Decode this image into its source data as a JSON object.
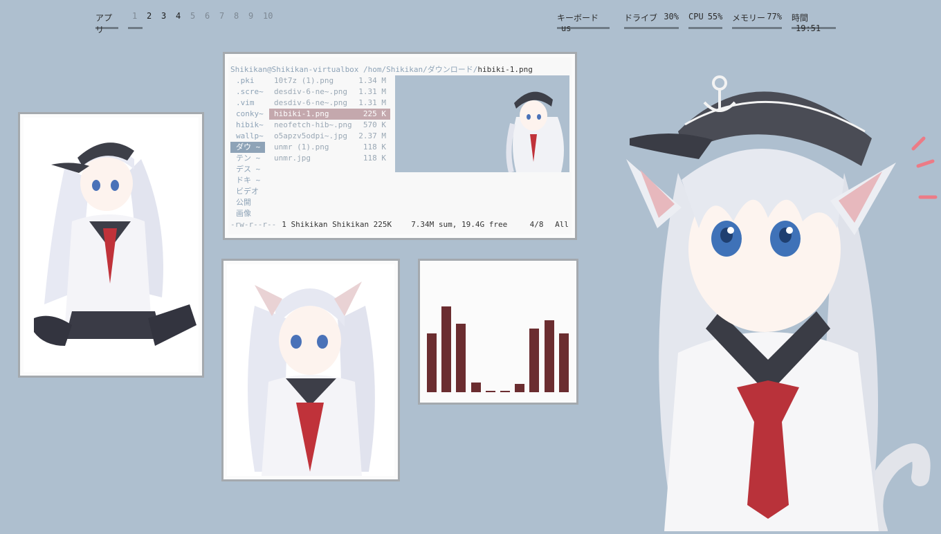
{
  "topbar": {
    "apps_label": "アプリ",
    "workspaces": [
      "1",
      "2",
      "3",
      "4",
      "5",
      "6",
      "7",
      "8",
      "9",
      "10"
    ],
    "active_workspaces": [
      "2",
      "3",
      "4"
    ],
    "stats": {
      "keyboard": {
        "label": "キーボード",
        "value": "us"
      },
      "drive": {
        "label": "ドライブ",
        "value": "30%"
      },
      "cpu": {
        "label": "CPU",
        "value": "55%"
      },
      "memory": {
        "label": "メモリー",
        "value": "77%"
      },
      "clock": {
        "label": "時間",
        "value": "19:51"
      }
    }
  },
  "terminal": {
    "path_prefix": "Shikikan@Shikikan-virtualbox /hom/Shikikan/ダウンロード/",
    "path_current": "hibiki-1.png",
    "left_column": [
      ".pki",
      ".scre~",
      ".vim",
      "conky~",
      "hibik~",
      "wallp~",
      "ダウ ~",
      "テン ~",
      "デス ~",
      "ドキ ~",
      "ビデオ",
      "公開",
      "画像"
    ],
    "left_selected_index": 6,
    "files": [
      {
        "name": "10t7z (1).png",
        "size": "1.34 M"
      },
      {
        "name": "desdiv-6-ne~.png",
        "size": "1.31 M"
      },
      {
        "name": "desdiv-6-ne~.png",
        "size": "1.31 M"
      },
      {
        "name": "hibiki-1.png",
        "size": "225 K"
      },
      {
        "name": "neofetch-hib~.png",
        "size": "570 K"
      },
      {
        "name": "o5apzv5odpi~.jpg",
        "size": "2.37 M"
      },
      {
        "name": "unmr (1).png",
        "size": "118 K"
      },
      {
        "name": "unmr.jpg",
        "size": "118 K"
      }
    ],
    "files_selected_index": 3,
    "status": {
      "perms": "-rw-r--r--",
      "info": "1 Shikikan Shikikan 225K",
      "sum": "7.34M sum, 19.4G free",
      "position": "4/8",
      "scroll": "All"
    }
  },
  "visualizer": {
    "levels": [
      0.5,
      0.73,
      0.58,
      0.08,
      0.01,
      0.01,
      0.07,
      0.54,
      0.61,
      0.5
    ],
    "color": "#6b2d30"
  },
  "colors": {
    "background": "#aebfcf",
    "accent_bar": "#6b2d30",
    "selection_highlight": "#c4a8ad"
  },
  "icons": {
    "anchor": "anchor-icon"
  }
}
